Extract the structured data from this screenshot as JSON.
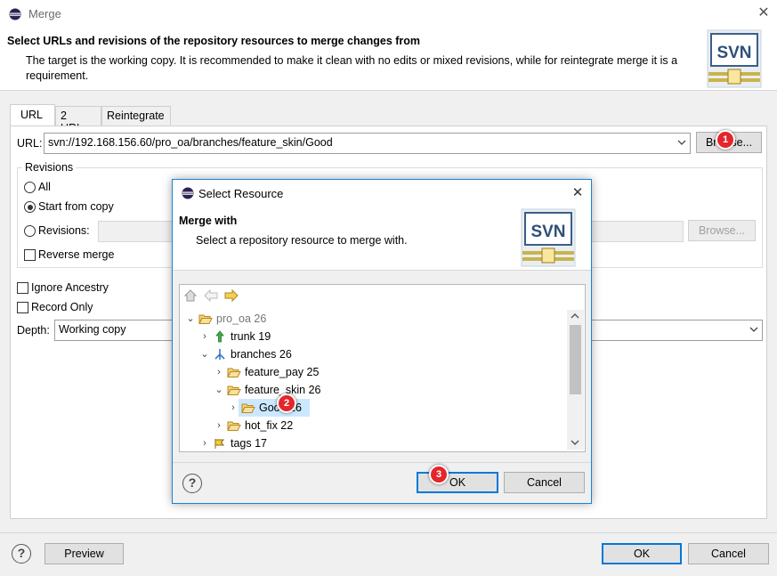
{
  "main": {
    "title": "Merge",
    "heading": "Select URLs and revisions of the repository resources to merge changes from",
    "description": "The target is the working copy. It is recommended to make it clean with no edits or mixed revisions, while for reintegrate merge it is a requirement.",
    "logo_text": "SVN",
    "tabs": [
      {
        "label": "URL",
        "active": true
      },
      {
        "label": "2 URLs",
        "active": false
      },
      {
        "label": "Reintegrate",
        "active": false
      }
    ],
    "url_label": "URL:",
    "url_value": "svn://192.168.156.60/pro_oa/branches/feature_skin/Good",
    "browse_label": "Browse...",
    "revisions_group": "Revisions",
    "radio_all": "All",
    "radio_start_from_copy": "Start from copy",
    "radio_revisions": "Revisions:",
    "revisions_value": "",
    "revisions_browse": "Browse...",
    "reverse_merge": "Reverse merge",
    "ignore_ancestry": "Ignore Ancestry",
    "record_only": "Record Only",
    "depth_label": "Depth:",
    "depth_value": "Working copy",
    "preview_label": "Preview",
    "ok_label": "OK",
    "cancel_label": "Cancel"
  },
  "dialog": {
    "title": "Select Resource",
    "heading": "Merge with",
    "description": "Select a repository resource to merge with.",
    "logo_text": "SVN",
    "tree": [
      {
        "label": "pro_oa 26",
        "icon": "open-folder-icon",
        "expanded": true,
        "dim": true
      },
      {
        "label": "trunk 19",
        "icon": "trunk-icon",
        "expanded": false
      },
      {
        "label": "branches 26",
        "icon": "branches-icon",
        "expanded": true
      },
      {
        "label": "feature_pay 25",
        "icon": "folder-icon",
        "expanded": false
      },
      {
        "label": "feature_skin 26",
        "icon": "open-folder-icon",
        "expanded": true
      },
      {
        "label": "Good 26",
        "icon": "folder-icon",
        "expanded": false,
        "selected": true
      },
      {
        "label": "hot_fix 22",
        "icon": "folder-icon",
        "expanded": false
      },
      {
        "label": "tags 17",
        "icon": "tags-icon",
        "expanded": false
      }
    ],
    "ok_label": "OK",
    "cancel_label": "Cancel"
  },
  "badges": [
    "1",
    "2",
    "3"
  ],
  "colors": {
    "accent": "#0078d7",
    "badge": "#e3262b",
    "selection": "#cce8ff",
    "folder": "#e8b64a"
  }
}
